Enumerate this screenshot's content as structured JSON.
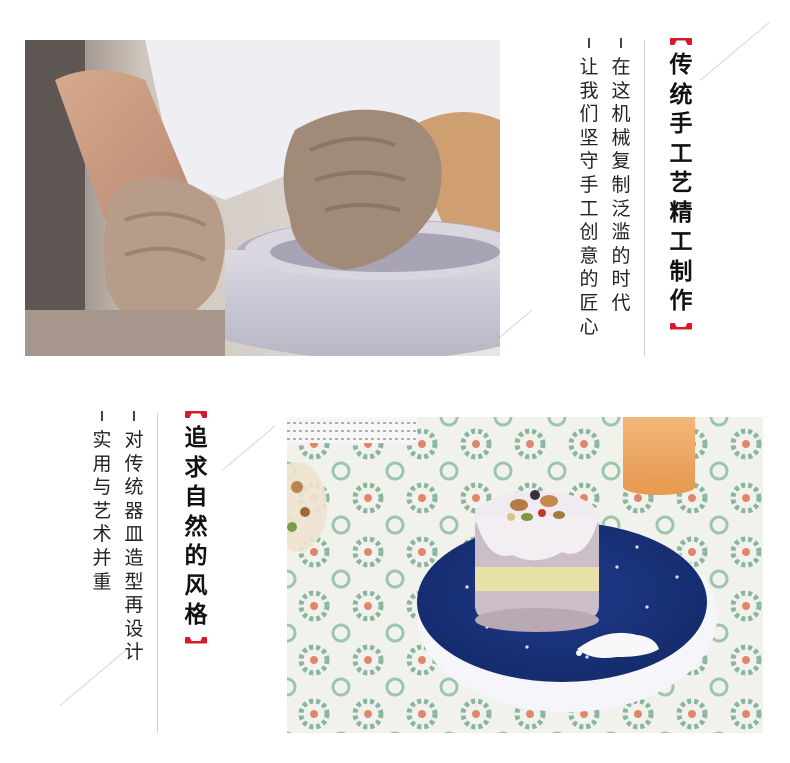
{
  "section1": {
    "title": "传统手工艺精工制作",
    "line1": "在这机械复制泛滥的时代",
    "line2": "让我们坚守手工创意的匠心"
  },
  "section2": {
    "title": "追求自然的风格",
    "line1": "对传统器皿造型再设计",
    "line2": "实用与艺术并重"
  },
  "colors": {
    "accent": "#d8192a",
    "text": "#1a1a1a"
  }
}
